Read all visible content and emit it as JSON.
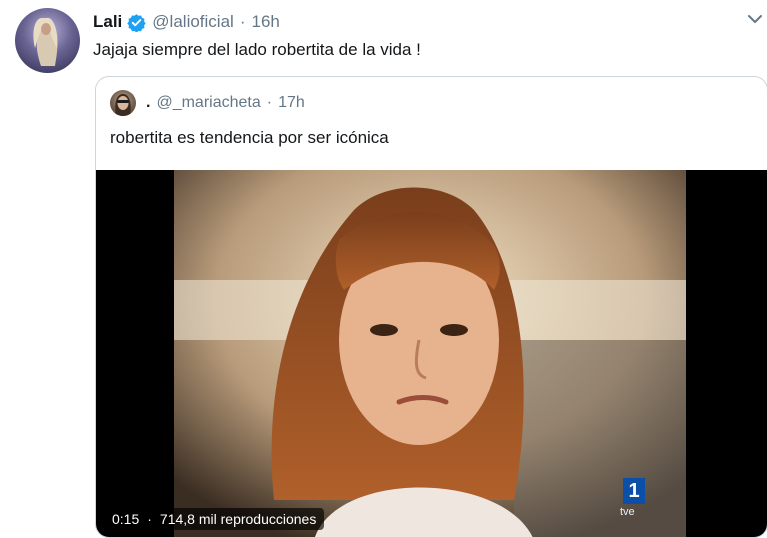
{
  "tweet": {
    "author_name": "Lali",
    "handle": "@lalioficial",
    "separator": "·",
    "time": "16h",
    "text": "Jajaja siempre del lado robertita de la vida !",
    "verified": true,
    "icons": {
      "avatar": "profile-avatar",
      "verified": "verified-badge-icon",
      "more": "chevron-down-icon"
    }
  },
  "quoted": {
    "author_name": ".",
    "handle": "@_mariacheta",
    "separator": "·",
    "time": "17h",
    "text": "robertita es tendencia por ser icónica",
    "media": {
      "type": "video",
      "time": "0:15",
      "separator": "·",
      "views": "714,8 mil reproducciones",
      "broadcaster_logo": "1",
      "broadcaster_sub": "tve"
    }
  },
  "colors": {
    "accent": "#1da1f2",
    "text": "#14171a",
    "secondary": "#657786",
    "border": "#ccd6dd"
  }
}
